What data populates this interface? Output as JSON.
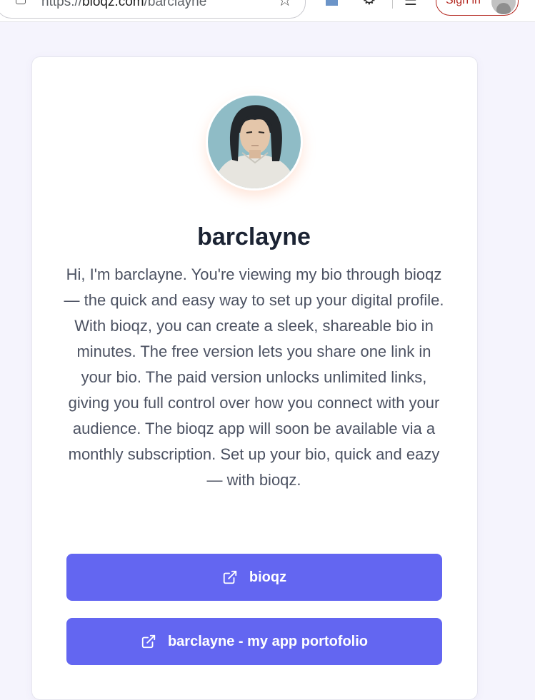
{
  "browser": {
    "url_prefix": "https://",
    "url_host": "bioqz.com",
    "url_path": "/barclayne",
    "signin_label": "Sign in"
  },
  "profile": {
    "name": "barclayne",
    "bio": "Hi, I'm barclayne. You're viewing my bio through bioqz — the quick and easy way to set up your digital profile. With bioqz, you can create a sleek, shareable bio in minutes. The free version lets you share one link in your bio. The paid version unlocks unlimited links, giving you full control over how you connect with your audience. The bioqz app will soon be available via a monthly subscription. Set up your bio, quick and eazy — with bioqz."
  },
  "links": [
    {
      "label": "bioqz",
      "icon": "external-link-icon"
    },
    {
      "label": "barclayne - my app portofolio",
      "icon": "external-link-icon"
    }
  ],
  "colors": {
    "button": "#6366f1",
    "page_background": "#f5f4fd",
    "name_text": "#1b2333",
    "bio_text": "#4c5262",
    "signin_accent": "#b3261e"
  }
}
